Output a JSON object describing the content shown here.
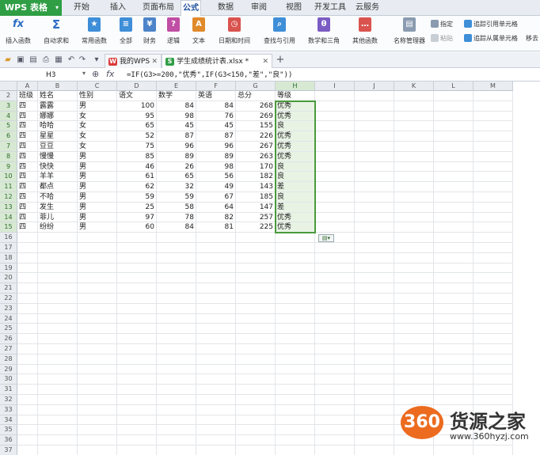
{
  "app": {
    "name": "WPS 表格",
    "dropdown": "▾"
  },
  "menu_tabs": [
    "开始",
    "插入",
    "页面布局",
    "公式",
    "数据",
    "审阅",
    "视图",
    "开发工具",
    "云服务"
  ],
  "active_menu_tab": "公式",
  "ribbon": {
    "insert_function": "插入函数",
    "autosum": "自动求和",
    "common_functions": "常用函数",
    "all": "全部",
    "financial": "财务",
    "logical": "逻辑",
    "text": "文本",
    "date_time": "日期和时间",
    "lookup": "查找与引用",
    "math_trig": "数学和三角",
    "other": "其他函数",
    "name_manager": "名称管理器",
    "specify": "指定",
    "paste": "粘贴",
    "trace_precedents": "追踪引用单元格",
    "trace_dependents": "追踪从属单元格",
    "remove": "移去"
  },
  "doc_tabs": [
    {
      "label": "我的WPS",
      "icon": "W"
    },
    {
      "label": "学生成绩统计表.xlsx *",
      "icon": "S"
    }
  ],
  "formula_bar": {
    "cell_ref": "H3",
    "fx": "fx",
    "formula": "=IF(G3>=200,\"优秀\",IF(G3<150,\"差\",\"良\"))"
  },
  "columns": [
    "A",
    "B",
    "C",
    "D",
    "E",
    "F",
    "G",
    "H",
    "I",
    "J",
    "K",
    "L",
    "M"
  ],
  "selected_column": "H",
  "rows": [
    {
      "n": "2",
      "cells": [
        "班级",
        "姓名",
        "性别",
        "语文",
        "数学",
        "英语",
        "总分",
        "等级"
      ]
    },
    {
      "n": "3",
      "cells": [
        "四",
        "露露",
        "男",
        "100",
        "84",
        "84",
        "268",
        "优秀"
      ]
    },
    {
      "n": "4",
      "cells": [
        "四",
        "娜娜",
        "女",
        "95",
        "98",
        "76",
        "269",
        "优秀"
      ]
    },
    {
      "n": "5",
      "cells": [
        "四",
        "哈哈",
        "女",
        "65",
        "45",
        "45",
        "155",
        "良"
      ]
    },
    {
      "n": "6",
      "cells": [
        "四",
        "星星",
        "女",
        "52",
        "87",
        "87",
        "226",
        "优秀"
      ]
    },
    {
      "n": "7",
      "cells": [
        "四",
        "豆豆",
        "女",
        "75",
        "96",
        "96",
        "267",
        "优秀"
      ]
    },
    {
      "n": "8",
      "cells": [
        "四",
        "慢慢",
        "男",
        "85",
        "89",
        "89",
        "263",
        "优秀"
      ]
    },
    {
      "n": "9",
      "cells": [
        "四",
        "快快",
        "男",
        "46",
        "26",
        "98",
        "170",
        "良"
      ]
    },
    {
      "n": "10",
      "cells": [
        "四",
        "羊羊",
        "男",
        "61",
        "65",
        "56",
        "182",
        "良"
      ]
    },
    {
      "n": "11",
      "cells": [
        "四",
        "都点",
        "男",
        "62",
        "32",
        "49",
        "143",
        "差"
      ]
    },
    {
      "n": "12",
      "cells": [
        "四",
        "不哈",
        "男",
        "59",
        "59",
        "67",
        "185",
        "良"
      ]
    },
    {
      "n": "13",
      "cells": [
        "四",
        "发生",
        "男",
        "25",
        "58",
        "64",
        "147",
        "差"
      ]
    },
    {
      "n": "14",
      "cells": [
        "四",
        "菲儿",
        "男",
        "97",
        "78",
        "82",
        "257",
        "优秀"
      ]
    },
    {
      "n": "15",
      "cells": [
        "四",
        "纷纷",
        "男",
        "60",
        "84",
        "81",
        "225",
        "优秀"
      ]
    }
  ],
  "empty_rows": [
    "16",
    "17",
    "18",
    "19",
    "20",
    "21",
    "22",
    "23",
    "24",
    "25",
    "26",
    "27",
    "28",
    "29",
    "30",
    "31",
    "32",
    "33",
    "34",
    "35",
    "36",
    "37"
  ],
  "watermark": {
    "logo": "360",
    "text": "货源之家",
    "url": "www.360hyzj.com"
  },
  "colors": {
    "accent": "#2f9e44",
    "selection": "#4a9a3c",
    "grade_fill": "#e8f3e4"
  }
}
